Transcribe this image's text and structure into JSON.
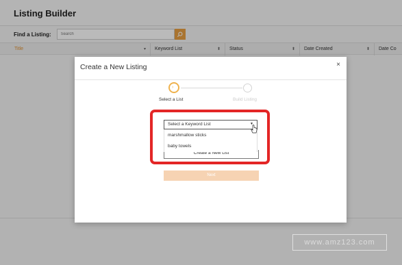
{
  "app": {
    "title": "Listing Builder",
    "find_label": "Find a Listing:",
    "search_placeholder": "Search",
    "columns": [
      {
        "label": "Title"
      },
      {
        "label": "Keyword List"
      },
      {
        "label": "Status"
      },
      {
        "label": "Date Created"
      },
      {
        "label": "Date Co"
      }
    ]
  },
  "modal": {
    "title": "Create a New Listing",
    "close_label": "×",
    "steps": [
      {
        "label": "Select a List",
        "state": "active"
      },
      {
        "label": "Build Listing",
        "state": "inactive"
      }
    ],
    "keyword_select": {
      "selected": "Select a Keyword List",
      "options": [
        "marshmallow sticks",
        "baby towels"
      ]
    },
    "create_button_label": "Create a New List",
    "next_button_label": "Next"
  },
  "watermark": "www.amz123.com",
  "colors": {
    "accent": "#e8a042",
    "highlight": "#e32626",
    "next_button": "#f6d3b3"
  }
}
